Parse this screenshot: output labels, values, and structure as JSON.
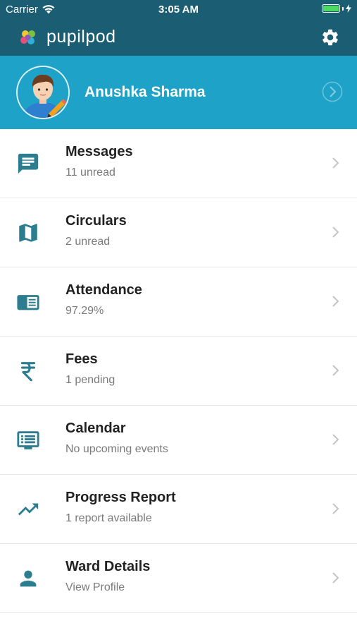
{
  "status_bar": {
    "carrier": "Carrier",
    "time": "3:05 AM"
  },
  "app": {
    "name": "pupilpod"
  },
  "profile": {
    "name": "Anushka Sharma"
  },
  "colors": {
    "header": "#1b5e73",
    "profile_band": "#1fa2c8",
    "icon": "#2b7d8f"
  },
  "menu": [
    {
      "title": "Messages",
      "subtitle": "11 unread",
      "icon": "message-icon"
    },
    {
      "title": "Circulars",
      "subtitle": "2 unread",
      "icon": "map-icon"
    },
    {
      "title": "Attendance",
      "subtitle": "97.29%",
      "icon": "register-icon"
    },
    {
      "title": "Fees",
      "subtitle": "1 pending",
      "icon": "rupee-icon"
    },
    {
      "title": "Calendar",
      "subtitle": "No upcoming events",
      "icon": "calendar-icon"
    },
    {
      "title": "Progress Report",
      "subtitle": "1 report available",
      "icon": "trending-up-icon"
    },
    {
      "title": "Ward Details",
      "subtitle": "View Profile",
      "icon": "person-icon"
    }
  ]
}
